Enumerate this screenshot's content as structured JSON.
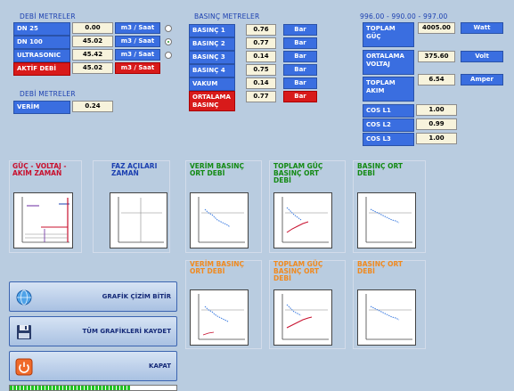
{
  "flow_meters": {
    "title": "DEBİ METRELER",
    "rows": [
      {
        "label": "DN 25",
        "value": "0.00",
        "unit": "m3 / Saat",
        "radio": "unchecked"
      },
      {
        "label": "DN 100",
        "value": "45.02",
        "unit": "m3 / Saat",
        "radio": "checked"
      },
      {
        "label": "ULTRASONIC",
        "value": "45.42",
        "unit": "m3 / Saat",
        "radio": "unchecked"
      },
      {
        "label": "AKTİF DEBİ",
        "value": "45.02",
        "unit": "m3 / Saat"
      }
    ]
  },
  "efficiency": {
    "title": "DEBİ METRELER",
    "label": "VERİM",
    "value": "0.24"
  },
  "pressure_meters": {
    "title": "BASINÇ METRELER",
    "rows": [
      {
        "label": "BASINÇ 1",
        "value": "0.76",
        "unit": "Bar"
      },
      {
        "label": "BASINÇ 2",
        "value": "0.77",
        "unit": "Bar"
      },
      {
        "label": "BASINÇ 3",
        "value": "0.14",
        "unit": "Bar"
      },
      {
        "label": "BASINÇ 4",
        "value": "0.75",
        "unit": "Bar"
      },
      {
        "label": "VAKUM",
        "value": "0.14",
        "unit": "Bar"
      },
      {
        "label": "ORTALAMA BASINÇ",
        "value": "0.77",
        "unit": "Bar"
      }
    ]
  },
  "power": {
    "title": "996.00 - 990.00 - 997.00",
    "rows": [
      {
        "label": "TOPLAM GÜÇ",
        "value": "4005.00",
        "unit": "Watt"
      },
      {
        "label": "ORTALAMA VOLTAJ",
        "value": "375.60",
        "unit": "Volt"
      },
      {
        "label": "TOPLAM AKIM",
        "value": "6.54",
        "unit": "Amper"
      }
    ],
    "cos": [
      {
        "label": "COS L1",
        "value": "1.00"
      },
      {
        "label": "COS L2",
        "value": "0.99"
      },
      {
        "label": "COS L3",
        "value": "1.00"
      }
    ]
  },
  "charts": [
    {
      "title": "GÜÇ - VOLTAJ - AKIM ZAMAN",
      "color": "#c8102e"
    },
    {
      "title": "FAZ AÇILARI ZAMAN",
      "color": "#1b3fb0"
    },
    {
      "title": "VERİM BASINÇ ORT DEBİ",
      "color": "#138a13"
    },
    {
      "title": "TOPLAM GÜÇ BASINÇ ORT DEBİ",
      "color": "#138a13"
    },
    {
      "title": "BASINÇ ORT DEBİ",
      "color": "#138a13"
    },
    {
      "title": "VERİM BASINÇ ORT DEBİ",
      "color": "#f08a20"
    },
    {
      "title": "TOPLAM GÜÇ BASINÇ ORT DEBİ",
      "color": "#f08a20"
    },
    {
      "title": "BASINÇ ORT DEBİ",
      "color": "#f08a20"
    }
  ],
  "buttons": {
    "stop_plot": "GRAFİK ÇİZİM BİTİR",
    "save_all": "TÜM GRAFİKLERİ KAYDET",
    "close": "KAPAT"
  },
  "progress": {
    "fraction": 0.72
  }
}
